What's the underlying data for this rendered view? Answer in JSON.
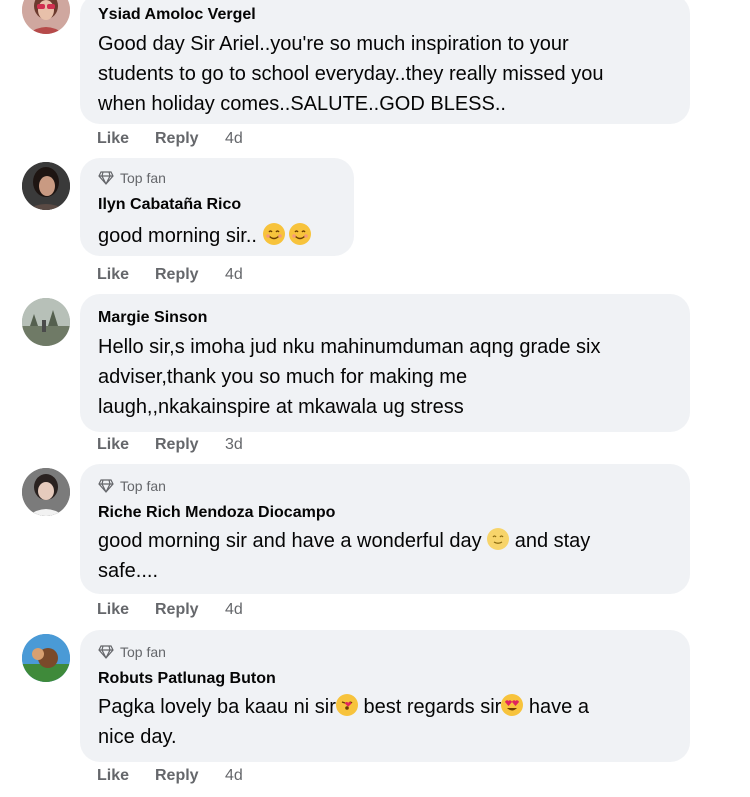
{
  "badge_label": "Top fan",
  "comments": [
    {
      "author": "Ysiad Amoloc Vergel",
      "top_fan": false,
      "lines": [
        "Good day Sir Ariel..you're so much inspiration to your",
        "students to go to school everyday..they really missed you",
        "when holiday comes..SALUTE..GOD BLESS.."
      ],
      "like_label": "Like",
      "reply_label": "Reply",
      "time": "4d"
    },
    {
      "author": "Ilyn Cabataña Rico",
      "top_fan": true,
      "lines": [
        "good morning sir.."
      ],
      "like_label": "Like",
      "reply_label": "Reply",
      "time": "4d"
    },
    {
      "author": "Margie Sinson",
      "top_fan": false,
      "lines": [
        "Hello sir,s imoha jud nku mahinumduman aqng grade six",
        "adviser,thank you so much for making me",
        "laugh,,nkakainspire at mkawala ug stress"
      ],
      "like_label": "Like",
      "reply_label": "Reply",
      "time": "3d"
    },
    {
      "author": "Riche Rich Mendoza Diocampo",
      "top_fan": true,
      "lines": [
        "good morning sir and have a wonderful day",
        "and stay",
        "safe...."
      ],
      "like_label": "Like",
      "reply_label": "Reply",
      "time": "4d"
    },
    {
      "author": "Robuts Patlunag Buton",
      "top_fan": true,
      "lines": [
        "Pagka lovely ba kaau ni sir",
        "best regards sir",
        "have a",
        "nice day."
      ],
      "like_label": "Like",
      "reply_label": "Reply",
      "time": "4d"
    }
  ],
  "colors": {
    "bubble": "#f0f2f5",
    "meta_text": "#65676b",
    "body_text": "#050505"
  },
  "icons": {
    "badge": "diamond-icon",
    "emoji_smile": "smiling-face-emoji",
    "emoji_kiss": "kissing-face-emoji",
    "emoji_heart_eyes": "heart-eyes-emoji"
  }
}
